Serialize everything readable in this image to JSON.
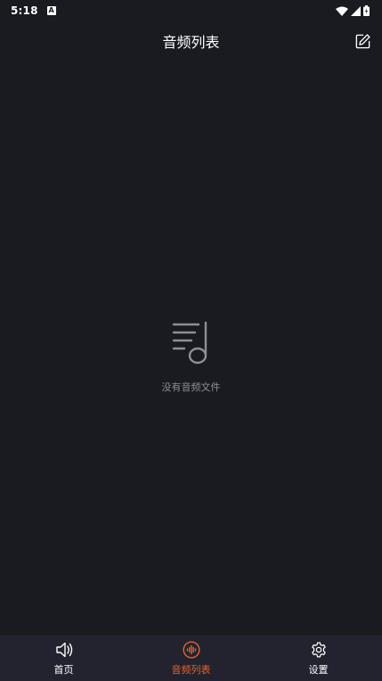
{
  "status_bar": {
    "time": "5:18",
    "notification_icon": "a-letter-icon",
    "icons": [
      "wifi-icon",
      "signal-icon",
      "battery-icon"
    ]
  },
  "header": {
    "title": "音频列表",
    "edit_icon": "edit-icon"
  },
  "empty_state": {
    "icon": "playlist-music-icon",
    "message": "没有音频文件"
  },
  "bottom_nav": {
    "items": [
      {
        "label": "首页",
        "icon": "speaker-icon",
        "active": false
      },
      {
        "label": "音频列表",
        "icon": "audio-wave-icon",
        "active": true
      },
      {
        "label": "设置",
        "icon": "gear-icon",
        "active": false
      }
    ]
  },
  "colors": {
    "background": "#1a1b20",
    "nav_background": "#22232e",
    "accent": "#e8622a",
    "text": "#ffffff",
    "muted_text": "#8e8f96"
  }
}
